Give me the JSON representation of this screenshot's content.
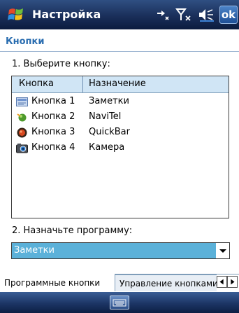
{
  "titlebar": {
    "title": "Настройка",
    "ok_label": "ok",
    "icons": [
      "start-menu-flag",
      "connectivity-icon",
      "signal-off-icon",
      "speaker-icon"
    ]
  },
  "page": {
    "heading": "Кнопки",
    "select_button_label": "1. Выберите кнопку:",
    "assign_program_label": "2. Назначьте программу:"
  },
  "list": {
    "columns": [
      "Кнопка",
      "Назначение"
    ],
    "rows": [
      {
        "name": "Кнопка 1",
        "value": "Заметки",
        "icon": "notes-icon"
      },
      {
        "name": "Кнопка 2",
        "value": "NaviTel",
        "icon": "navitel-icon"
      },
      {
        "name": "Кнопка 3",
        "value": "QuickBar",
        "icon": "quickbar-icon"
      },
      {
        "name": "Кнопка 4",
        "value": "Камера",
        "icon": "camera-icon"
      }
    ]
  },
  "program_select": {
    "selected": "Заметки"
  },
  "tabs": {
    "items": [
      "Программные кнопки",
      "Управление кнопками"
    ],
    "active": 0
  },
  "colors": {
    "accent": "#2a6db0",
    "selection": "#5bb1d9",
    "header_bg": "#d0e5f5"
  }
}
